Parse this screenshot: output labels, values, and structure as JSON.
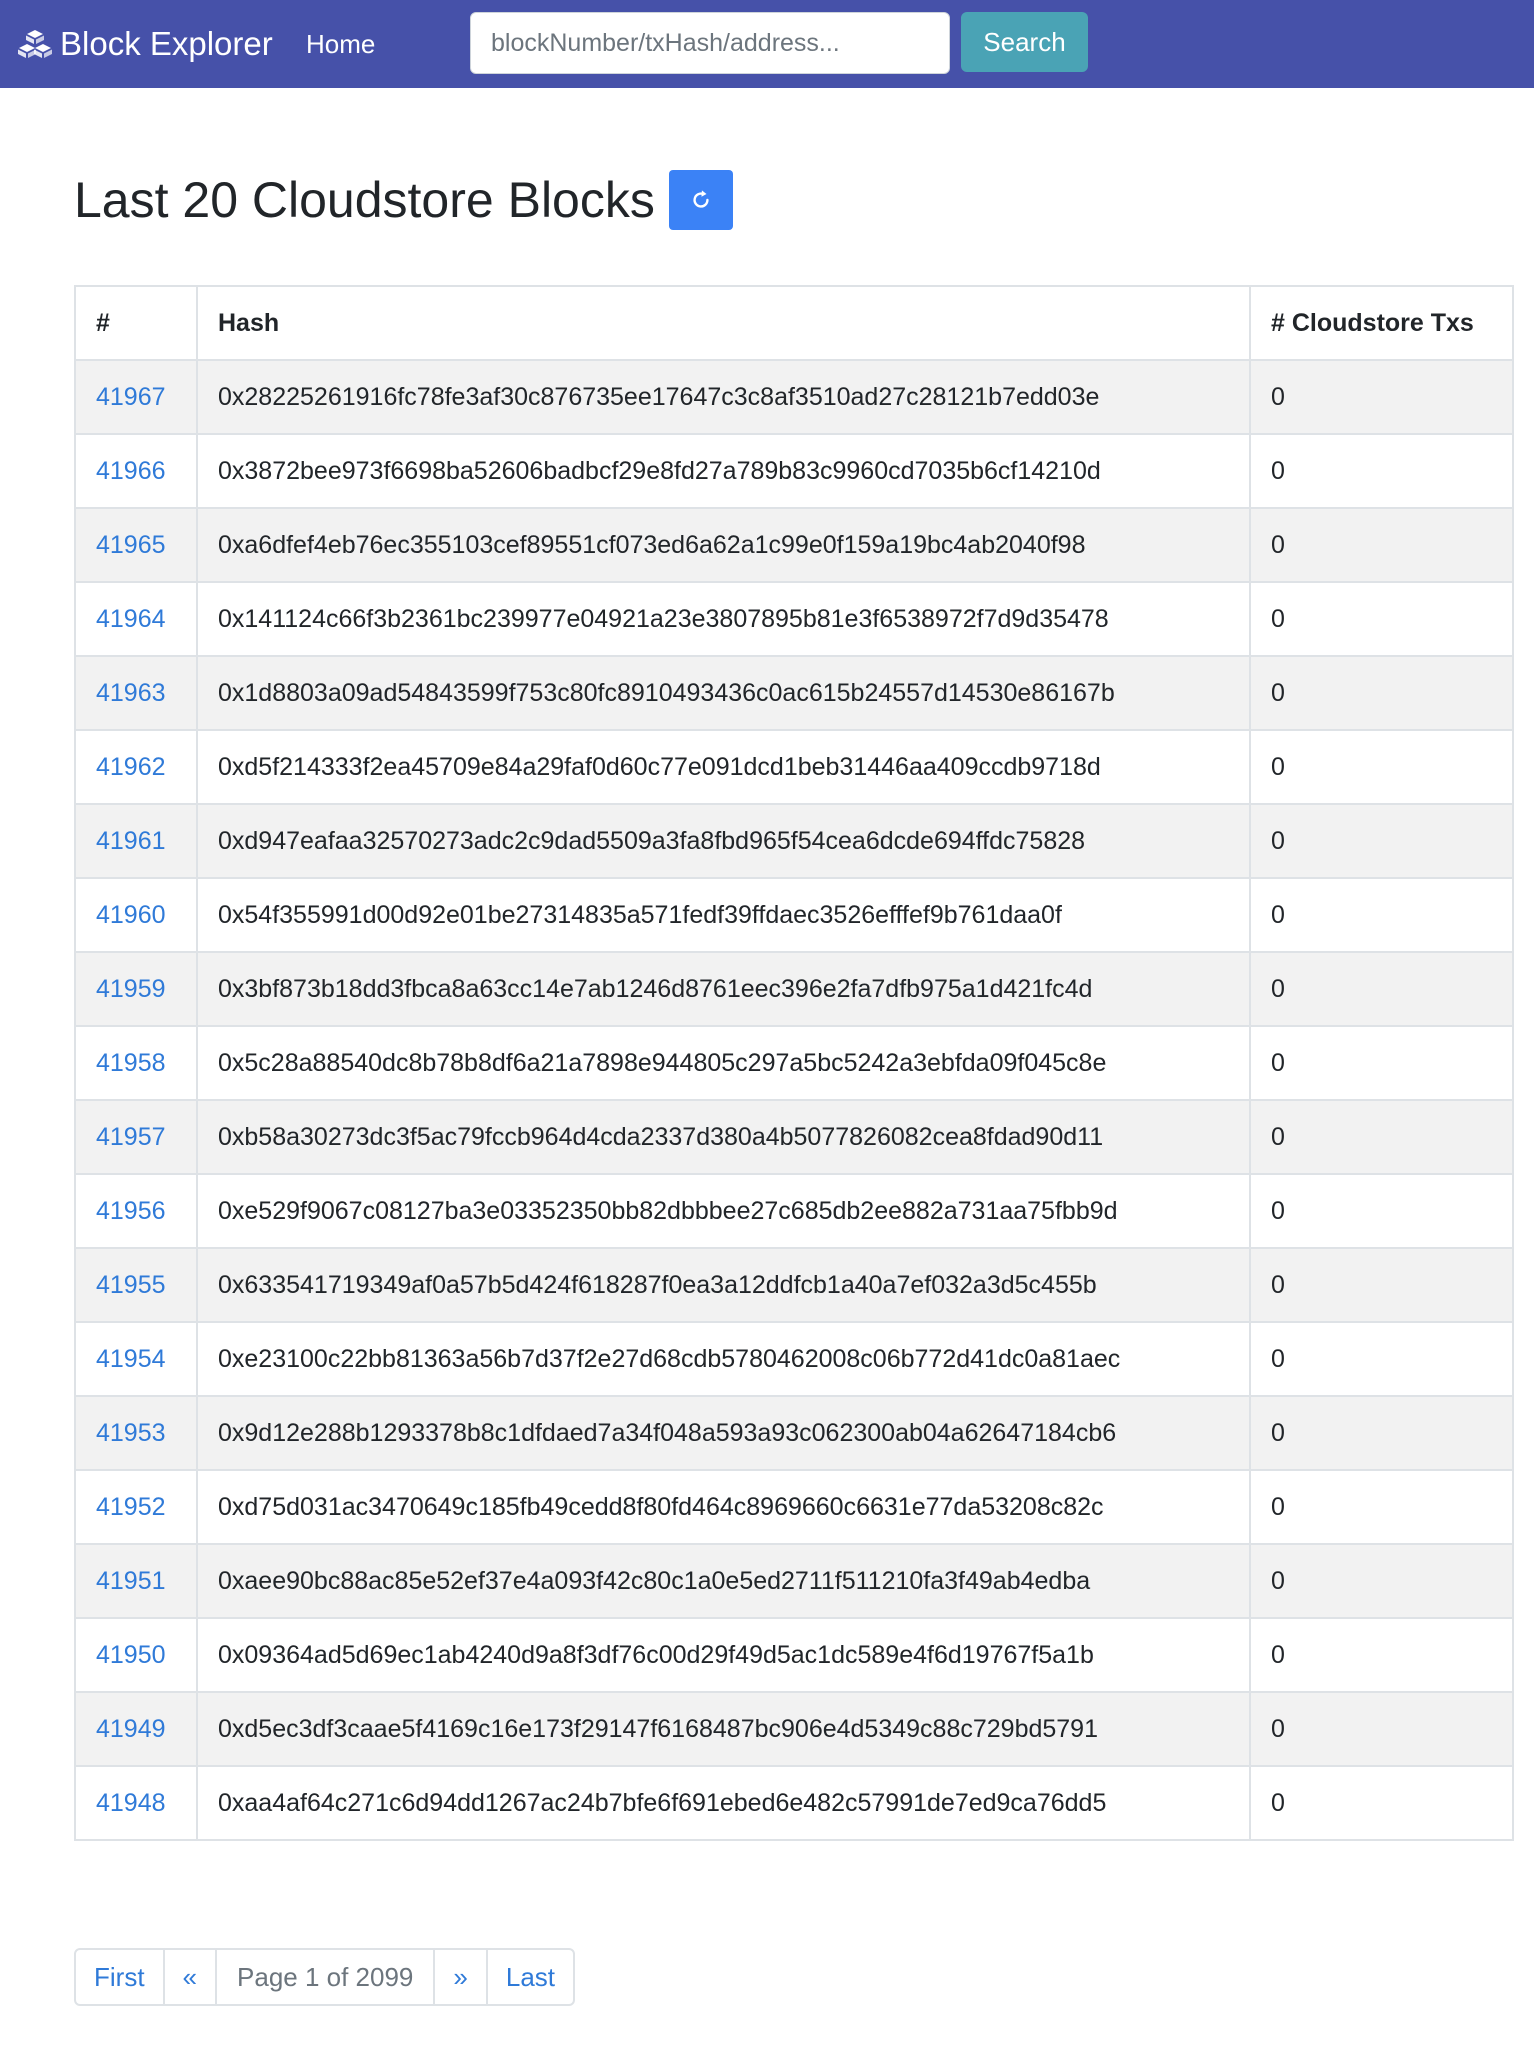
{
  "navbar": {
    "brand": "Block Explorer",
    "brand_icon": "cubes-icon",
    "home_label": "Home",
    "search_placeholder": "blockNumber/txHash/address...",
    "search_value": "",
    "search_button_label": "Search",
    "colors": {
      "background": "#4651a9",
      "search_button": "#4aa3b5"
    }
  },
  "main": {
    "title": "Last 20 Cloudstore Blocks",
    "refresh_icon": "refresh-icon",
    "refresh_color": "#3b82f6"
  },
  "table": {
    "headers": [
      "#",
      "Hash",
      "# Cloudstore Txs"
    ],
    "rows": [
      {
        "number": "41967",
        "hash": "0x28225261916fc78fe3af30c876735ee17647c3c8af3510ad27c28121b7edd03e",
        "txs": "0"
      },
      {
        "number": "41966",
        "hash": "0x3872bee973f6698ba52606badbcf29e8fd27a789b83c9960cd7035b6cf14210d",
        "txs": "0"
      },
      {
        "number": "41965",
        "hash": "0xa6dfef4eb76ec355103cef89551cf073ed6a62a1c99e0f159a19bc4ab2040f98",
        "txs": "0"
      },
      {
        "number": "41964",
        "hash": "0x141124c66f3b2361bc239977e04921a23e3807895b81e3f6538972f7d9d35478",
        "txs": "0"
      },
      {
        "number": "41963",
        "hash": "0x1d8803a09ad54843599f753c80fc8910493436c0ac615b24557d14530e86167b",
        "txs": "0"
      },
      {
        "number": "41962",
        "hash": "0xd5f214333f2ea45709e84a29faf0d60c77e091dcd1beb31446aa409ccdb9718d",
        "txs": "0"
      },
      {
        "number": "41961",
        "hash": "0xd947eafaa32570273adc2c9dad5509a3fa8fbd965f54cea6dcde694ffdc75828",
        "txs": "0"
      },
      {
        "number": "41960",
        "hash": "0x54f355991d00d92e01be27314835a571fedf39ffdaec3526efffef9b761daa0f",
        "txs": "0"
      },
      {
        "number": "41959",
        "hash": "0x3bf873b18dd3fbca8a63cc14e7ab1246d8761eec396e2fa7dfb975a1d421fc4d",
        "txs": "0"
      },
      {
        "number": "41958",
        "hash": "0x5c28a88540dc8b78b8df6a21a7898e944805c297a5bc5242a3ebfda09f045c8e",
        "txs": "0"
      },
      {
        "number": "41957",
        "hash": "0xb58a30273dc3f5ac79fccb964d4cda2337d380a4b5077826082cea8fdad90d11",
        "txs": "0"
      },
      {
        "number": "41956",
        "hash": "0xe529f9067c08127ba3e03352350bb82dbbbee27c685db2ee882a731aa75fbb9d",
        "txs": "0"
      },
      {
        "number": "41955",
        "hash": "0x633541719349af0a57b5d424f618287f0ea3a12ddfcb1a40a7ef032a3d5c455b",
        "txs": "0"
      },
      {
        "number": "41954",
        "hash": "0xe23100c22bb81363a56b7d37f2e27d68cdb5780462008c06b772d41dc0a81aec",
        "txs": "0"
      },
      {
        "number": "41953",
        "hash": "0x9d12e288b1293378b8c1dfdaed7a34f048a593a93c062300ab04a62647184cb6",
        "txs": "0"
      },
      {
        "number": "41952",
        "hash": "0xd75d031ac3470649c185fb49cedd8f80fd464c8969660c6631e77da53208c82c",
        "txs": "0"
      },
      {
        "number": "41951",
        "hash": "0xaee90bc88ac85e52ef37e4a093f42c80c1a0e5ed2711f511210fa3f49ab4edba",
        "txs": "0"
      },
      {
        "number": "41950",
        "hash": "0x09364ad5d69ec1ab4240d9a8f3df76c00d29f49d5ac1dc589e4f6d19767f5a1b",
        "txs": "0"
      },
      {
        "number": "41949",
        "hash": "0xd5ec3df3caae5f4169c16e173f29147f6168487bc906e4d5349c88c729bd5791",
        "txs": "0"
      },
      {
        "number": "41948",
        "hash": "0xaa4af64c271c6d94dd1267ac24b7bfe6f691ebed6e482c57991de7ed9ca76dd5",
        "txs": "0"
      }
    ]
  },
  "pagination": {
    "first": "First",
    "prev": "«",
    "info": "Page 1 of 2099",
    "next": "»",
    "last": "Last"
  }
}
